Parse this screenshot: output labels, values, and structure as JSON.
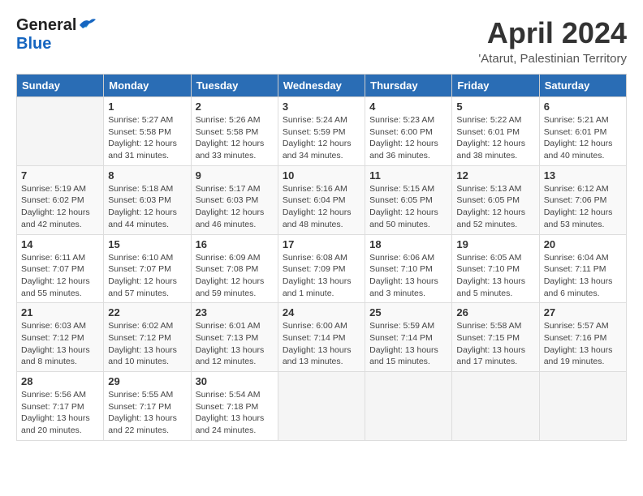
{
  "header": {
    "logo_general": "General",
    "logo_blue": "Blue",
    "month_title": "April 2024",
    "subtitle": "'Atarut, Palestinian Territory"
  },
  "calendar": {
    "days_of_week": [
      "Sunday",
      "Monday",
      "Tuesday",
      "Wednesday",
      "Thursday",
      "Friday",
      "Saturday"
    ],
    "weeks": [
      [
        {
          "day": "",
          "info": ""
        },
        {
          "day": "1",
          "info": "Sunrise: 5:27 AM\nSunset: 5:58 PM\nDaylight: 12 hours\nand 31 minutes."
        },
        {
          "day": "2",
          "info": "Sunrise: 5:26 AM\nSunset: 5:58 PM\nDaylight: 12 hours\nand 33 minutes."
        },
        {
          "day": "3",
          "info": "Sunrise: 5:24 AM\nSunset: 5:59 PM\nDaylight: 12 hours\nand 34 minutes."
        },
        {
          "day": "4",
          "info": "Sunrise: 5:23 AM\nSunset: 6:00 PM\nDaylight: 12 hours\nand 36 minutes."
        },
        {
          "day": "5",
          "info": "Sunrise: 5:22 AM\nSunset: 6:01 PM\nDaylight: 12 hours\nand 38 minutes."
        },
        {
          "day": "6",
          "info": "Sunrise: 5:21 AM\nSunset: 6:01 PM\nDaylight: 12 hours\nand 40 minutes."
        }
      ],
      [
        {
          "day": "7",
          "info": "Sunrise: 5:19 AM\nSunset: 6:02 PM\nDaylight: 12 hours\nand 42 minutes."
        },
        {
          "day": "8",
          "info": "Sunrise: 5:18 AM\nSunset: 6:03 PM\nDaylight: 12 hours\nand 44 minutes."
        },
        {
          "day": "9",
          "info": "Sunrise: 5:17 AM\nSunset: 6:03 PM\nDaylight: 12 hours\nand 46 minutes."
        },
        {
          "day": "10",
          "info": "Sunrise: 5:16 AM\nSunset: 6:04 PM\nDaylight: 12 hours\nand 48 minutes."
        },
        {
          "day": "11",
          "info": "Sunrise: 5:15 AM\nSunset: 6:05 PM\nDaylight: 12 hours\nand 50 minutes."
        },
        {
          "day": "12",
          "info": "Sunrise: 5:13 AM\nSunset: 6:05 PM\nDaylight: 12 hours\nand 52 minutes."
        },
        {
          "day": "13",
          "info": "Sunrise: 6:12 AM\nSunset: 7:06 PM\nDaylight: 12 hours\nand 53 minutes."
        }
      ],
      [
        {
          "day": "14",
          "info": "Sunrise: 6:11 AM\nSunset: 7:07 PM\nDaylight: 12 hours\nand 55 minutes."
        },
        {
          "day": "15",
          "info": "Sunrise: 6:10 AM\nSunset: 7:07 PM\nDaylight: 12 hours\nand 57 minutes."
        },
        {
          "day": "16",
          "info": "Sunrise: 6:09 AM\nSunset: 7:08 PM\nDaylight: 12 hours\nand 59 minutes."
        },
        {
          "day": "17",
          "info": "Sunrise: 6:08 AM\nSunset: 7:09 PM\nDaylight: 13 hours\nand 1 minute."
        },
        {
          "day": "18",
          "info": "Sunrise: 6:06 AM\nSunset: 7:10 PM\nDaylight: 13 hours\nand 3 minutes."
        },
        {
          "day": "19",
          "info": "Sunrise: 6:05 AM\nSunset: 7:10 PM\nDaylight: 13 hours\nand 5 minutes."
        },
        {
          "day": "20",
          "info": "Sunrise: 6:04 AM\nSunset: 7:11 PM\nDaylight: 13 hours\nand 6 minutes."
        }
      ],
      [
        {
          "day": "21",
          "info": "Sunrise: 6:03 AM\nSunset: 7:12 PM\nDaylight: 13 hours\nand 8 minutes."
        },
        {
          "day": "22",
          "info": "Sunrise: 6:02 AM\nSunset: 7:12 PM\nDaylight: 13 hours\nand 10 minutes."
        },
        {
          "day": "23",
          "info": "Sunrise: 6:01 AM\nSunset: 7:13 PM\nDaylight: 13 hours\nand 12 minutes."
        },
        {
          "day": "24",
          "info": "Sunrise: 6:00 AM\nSunset: 7:14 PM\nDaylight: 13 hours\nand 13 minutes."
        },
        {
          "day": "25",
          "info": "Sunrise: 5:59 AM\nSunset: 7:14 PM\nDaylight: 13 hours\nand 15 minutes."
        },
        {
          "day": "26",
          "info": "Sunrise: 5:58 AM\nSunset: 7:15 PM\nDaylight: 13 hours\nand 17 minutes."
        },
        {
          "day": "27",
          "info": "Sunrise: 5:57 AM\nSunset: 7:16 PM\nDaylight: 13 hours\nand 19 minutes."
        }
      ],
      [
        {
          "day": "28",
          "info": "Sunrise: 5:56 AM\nSunset: 7:17 PM\nDaylight: 13 hours\nand 20 minutes."
        },
        {
          "day": "29",
          "info": "Sunrise: 5:55 AM\nSunset: 7:17 PM\nDaylight: 13 hours\nand 22 minutes."
        },
        {
          "day": "30",
          "info": "Sunrise: 5:54 AM\nSunset: 7:18 PM\nDaylight: 13 hours\nand 24 minutes."
        },
        {
          "day": "",
          "info": ""
        },
        {
          "day": "",
          "info": ""
        },
        {
          "day": "",
          "info": ""
        },
        {
          "day": "",
          "info": ""
        }
      ]
    ]
  }
}
